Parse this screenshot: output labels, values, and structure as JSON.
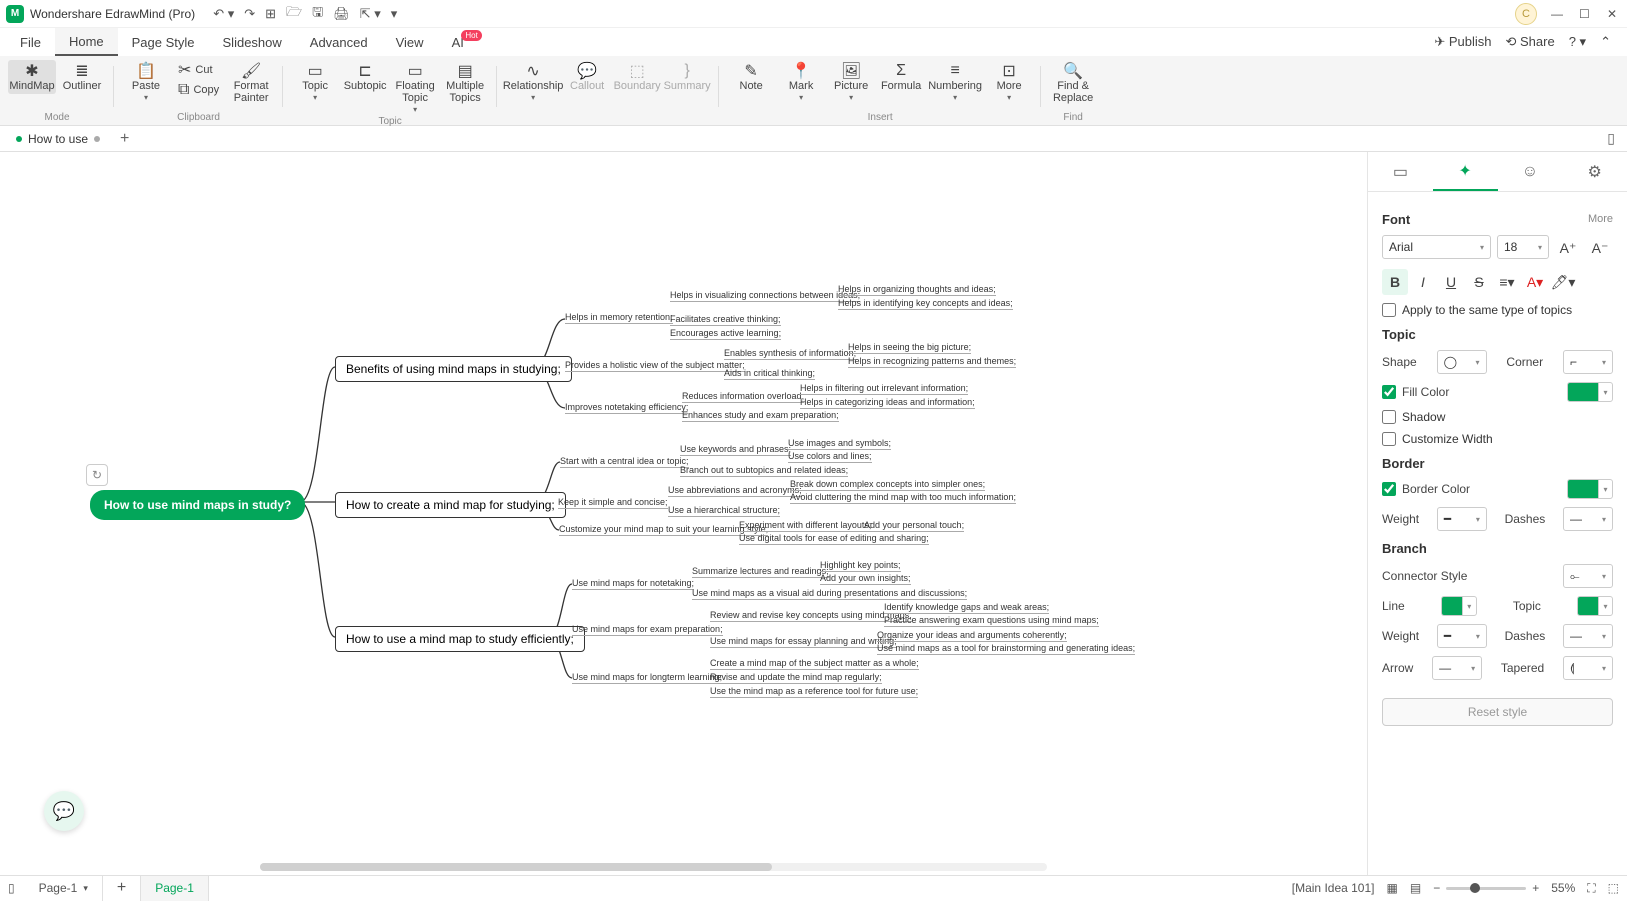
{
  "app": {
    "title": "Wondershare EdrawMind (Pro)"
  },
  "avatar_letter": "C",
  "menu": {
    "items": [
      "File",
      "Home",
      "Page Style",
      "Slideshow",
      "Advanced",
      "View",
      "AI"
    ],
    "active": "Home",
    "publish": "Publish",
    "share": "Share"
  },
  "ribbon": {
    "mode": {
      "label": "Mode",
      "mindmap": "MindMap",
      "outliner": "Outliner"
    },
    "clipboard": {
      "label": "Clipboard",
      "paste": "Paste",
      "cut": "Cut",
      "copy": "Copy",
      "formatpainter": "Format\nPainter"
    },
    "topic": {
      "label": "Topic",
      "topic": "Topic",
      "subtopic": "Subtopic",
      "floating": "Floating\nTopic",
      "multiple": "Multiple\nTopics"
    },
    "relationship": "Relationship",
    "callout": "Callout",
    "boundary": "Boundary",
    "summary": "Summary",
    "insert": {
      "label": "Insert",
      "note": "Note",
      "mark": "Mark",
      "picture": "Picture",
      "formula": "Formula",
      "numbering": "Numbering",
      "more": "More"
    },
    "find": {
      "label": "Find",
      "findreplace": "Find &\nReplace"
    }
  },
  "doctab": {
    "name": "How to use"
  },
  "mindmap": {
    "root": "How to use mind maps in study?",
    "b1": "Benefits of using mind maps in studying;",
    "b2": "How to create a mind map for studying;",
    "b3": "How to use a mind map to study efficiently;",
    "l": {
      "a1": "Helps in memory retention;",
      "a2": "Provides a holistic view of the subject matter;",
      "a3": "Improves notetaking efficiency;",
      "a1a": "Helps in visualizing connections between ideas;",
      "a1b": "Facilitates creative thinking;",
      "a1c": "Encourages active learning;",
      "a1a1": "Helps in organizing thoughts and ideas;",
      "a1a2": "Helps in identifying key concepts and ideas;",
      "a2a": "Enables synthesis of information;",
      "a2b": "Aids in critical thinking;",
      "a2a1": "Helps in seeing the big picture;",
      "a2a2": "Helps in recognizing patterns and themes;",
      "a3a": "Reduces information overload;",
      "a3b": "Enhances study and exam preparation;",
      "a3a1": "Helps in filtering out irrelevant information;",
      "a3a2": "Helps in categorizing ideas and information;",
      "b1": "Start with a central idea or topic;",
      "b2": "Keep it simple and concise;",
      "b3": "Customize your mind map to suit your learning style;",
      "b1a": "Use keywords and phrases;",
      "b1b": "Branch out to subtopics and related ideas;",
      "b1a1": "Use images and symbols;",
      "b1a2": "Use colors and lines;",
      "b2a": "Use abbreviations and acronyms;",
      "b2b": "Use a hierarchical structure;",
      "b2a1": "Break down complex concepts into simpler ones;",
      "b2a2": "Avoid cluttering the mind map with too much information;",
      "b3a": "Experiment with different layouts;",
      "b3b": "Use digital tools for ease of editing and sharing;",
      "b3a1": "Add your personal touch;",
      "c1": "Use mind maps for notetaking;",
      "c2": "Use mind maps for exam preparation;",
      "c3": "Use mind maps for longterm learning;",
      "c1a": "Summarize lectures and readings;",
      "c1b": "Use mind maps as a visual aid during presentations and discussions;",
      "c1a1": "Highlight key points;",
      "c1a2": "Add your own insights;",
      "c2a": "Review and revise key concepts using mind maps;",
      "c2b": "Use mind maps for essay planning and writing;",
      "c2a1": "Identify knowledge gaps and weak areas;",
      "c2a2": "Practice answering exam questions using mind maps;",
      "c2b1": "Organize your ideas and arguments coherently;",
      "c2b2": "Use mind maps as a tool for brainstorming and generating ideas;",
      "c3a": "Create a mind map of the subject matter as a whole;",
      "c3b": "Revise and update the mind map regularly;",
      "c3c": "Use the mind map as a reference tool for future use;"
    }
  },
  "side": {
    "font": {
      "title": "Font",
      "more": "More",
      "name": "Arial",
      "size": "18",
      "apply": "Apply to the same type of topics"
    },
    "topic": {
      "title": "Topic",
      "shape": "Shape",
      "corner": "Corner",
      "fill": "Fill Color",
      "shadow": "Shadow",
      "custw": "Customize Width"
    },
    "border": {
      "title": "Border",
      "bcolor": "Border Color",
      "weight": "Weight",
      "dashes": "Dashes"
    },
    "branch": {
      "title": "Branch",
      "connstyle": "Connector Style",
      "line": "Line",
      "topic": "Topic",
      "weight": "Weight",
      "dashes": "Dashes",
      "arrow": "Arrow",
      "tapered": "Tapered"
    },
    "reset": "Reset style",
    "fill_color": "#03a65a",
    "border_color": "#03a65a",
    "line_color": "#03a65a",
    "topic_color": "#03a65a"
  },
  "status": {
    "page1": "Page-1",
    "page1b": "Page-1",
    "idea": "[Main Idea 101]",
    "zoom": "55%"
  }
}
